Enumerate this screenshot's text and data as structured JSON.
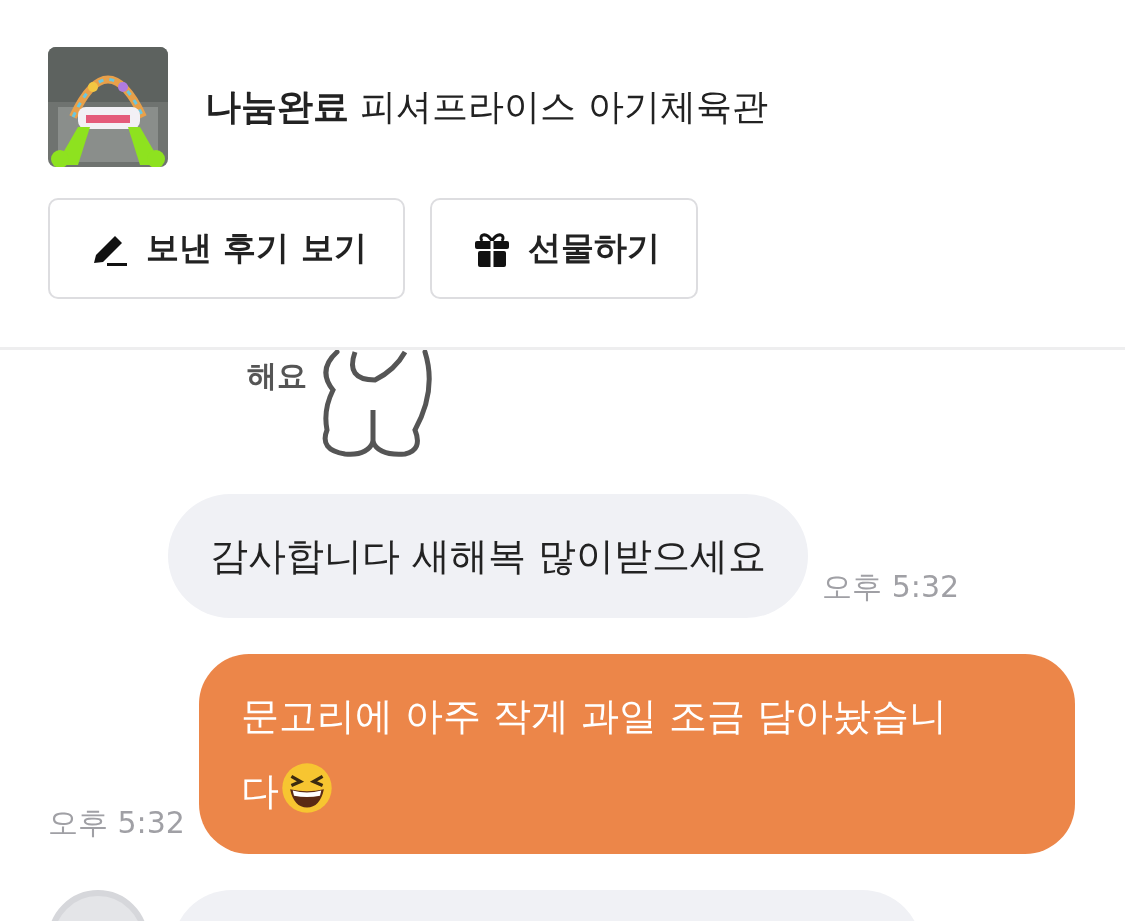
{
  "header": {
    "product": {
      "kind": "picture",
      "status": "나눔완료",
      "title": "피셔프라이스 아기체육관"
    },
    "buttons": [
      {
        "kind": "review",
        "label": "보낸 후기 보기"
      },
      {
        "kind": "gift",
        "label": "선물하기"
      }
    ]
  },
  "messages": [
    {
      "kind": "sticker",
      "caption": "해요"
    },
    {
      "kind": "text",
      "outgoing": false,
      "text": "감사합니다 새해복 많이받으세요",
      "time": "오후 5:32"
    },
    {
      "kind": "text",
      "outgoing": true,
      "text": "문고리에 아주 작게 과일 조금 담아놨습니다",
      "trailing_emoji": true,
      "time": "오후 5:32"
    },
    {
      "kind": "partial"
    }
  ]
}
